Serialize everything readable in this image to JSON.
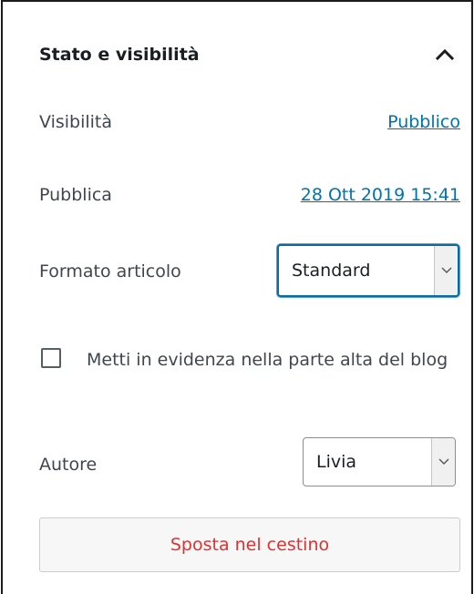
{
  "panel": {
    "title": "Stato e visibilità",
    "toggle_icon": "chevron-up-icon"
  },
  "visibility": {
    "label": "Visibilità",
    "value": "Pubblico"
  },
  "publish": {
    "label": "Pubblica",
    "value": "28 Ott 2019 15:41"
  },
  "post_format": {
    "label": "Formato articolo",
    "selected": "Standard"
  },
  "sticky": {
    "label": "Metti in evidenza nella parte alta del blog",
    "checked": false
  },
  "author": {
    "label": "Autore",
    "selected": "Livia"
  },
  "trash": {
    "label": "Sposta nel cestino"
  },
  "colors": {
    "link": "#0073aa",
    "danger": "#dc3232",
    "focus": "#0a6c9e"
  }
}
